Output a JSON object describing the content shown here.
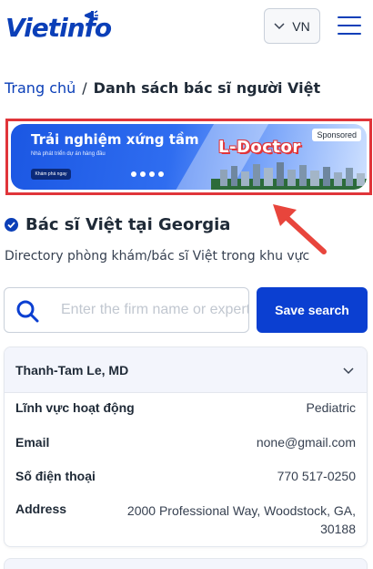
{
  "header": {
    "logo_text": "Vietinfo",
    "language": "VN",
    "icons": {
      "logo": "megaphone-icon",
      "language_chevron": "chevron-down-icon",
      "menu": "hamburger-menu-icon"
    },
    "brand_color": "#0b3fb8"
  },
  "breadcrumb": {
    "home": "Trang chủ",
    "separator": "/",
    "current": "Danh sách bác sĩ người Việt"
  },
  "banner": {
    "title": "Trải nghiệm xứng tầm",
    "subtitle": "Nhà phát triển dự án hàng đầu",
    "cta": "Khám phá ngay",
    "brand": "L-Doctor",
    "sponsored_label": "Sponsored",
    "highlight_color": "#e0353a"
  },
  "section": {
    "title": "Bác sĩ Việt tại Georgia",
    "description": "Directory phòng khám/bác sĩ Việt trong khu vực",
    "icons": {
      "title_badge": "verified-check-icon"
    }
  },
  "search": {
    "placeholder": "Enter the firm name or expertise",
    "value": "",
    "button_label": "Save search",
    "icons": {
      "search": "search-icon"
    }
  },
  "listings": [
    {
      "name": "Thanh-Tam Le, MD",
      "fields": [
        {
          "label": "Lĩnh vực hoạt động",
          "value": "Pediatric"
        },
        {
          "label": "Email",
          "value": "none@gmail.com"
        },
        {
          "label": "Số điện thoại",
          "value": "770 517-0250"
        },
        {
          "label": "Address",
          "value": "2000 Professional Way, Woodstock, GA, 30188"
        }
      ]
    }
  ]
}
